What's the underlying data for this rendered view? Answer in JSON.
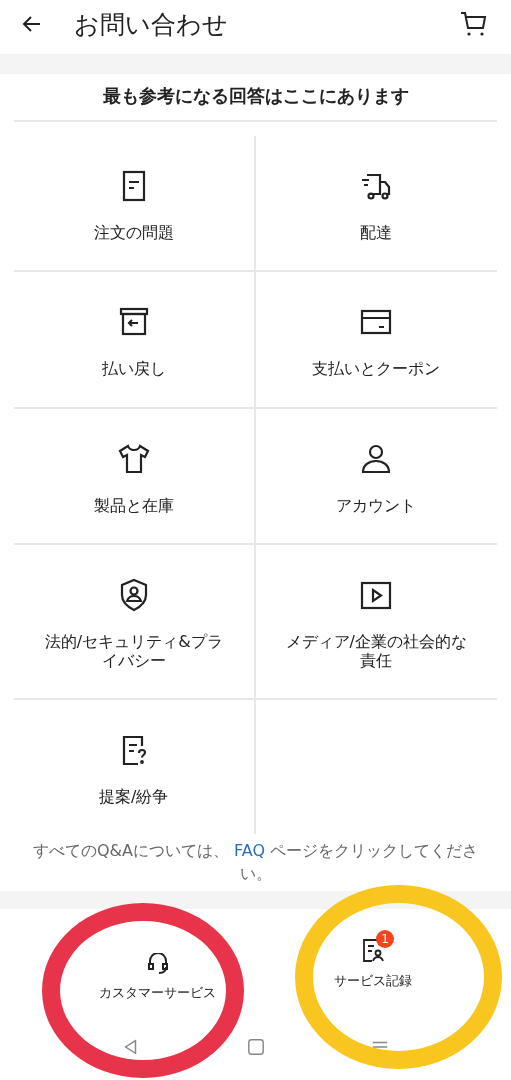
{
  "header": {
    "title": "お問い合わせ"
  },
  "heading": "最も参考になる回答はここにあります",
  "topics": [
    {
      "label": "注文の問題"
    },
    {
      "label": "配達"
    },
    {
      "label": "払い戻し"
    },
    {
      "label": "支払いとクーポン"
    },
    {
      "label": "製品と在庫"
    },
    {
      "label": "アカウント"
    },
    {
      "label": "法的/セキュリティ&プライバシー"
    },
    {
      "label": "メディア/企業の社会的な責任"
    },
    {
      "label": "提案/紛争"
    }
  ],
  "faq_note": {
    "before": "すべてのQ&Aについては、",
    "link": "FAQ",
    "after": "ページをクリックしてください。"
  },
  "bottom_actions": [
    {
      "label": "カスタマーサービス"
    },
    {
      "label": "サービス記録",
      "badge": "1"
    }
  ],
  "annotations": [
    {
      "color": "#e8344a"
    },
    {
      "color": "#f8c61e"
    }
  ]
}
